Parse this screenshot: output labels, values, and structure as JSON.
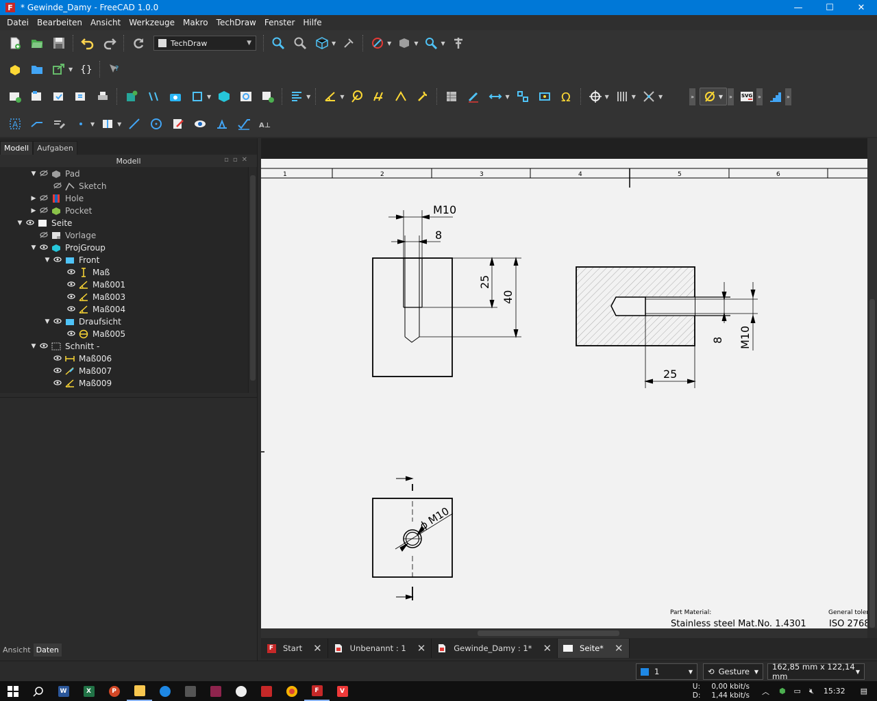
{
  "window": {
    "title": "* Gewinde_Damy - FreeCAD 1.0.0",
    "app_icon_letter": "F",
    "minimize": "—",
    "maximize": "☐",
    "close": "✕"
  },
  "menu": [
    "Datei",
    "Bearbeiten",
    "Ansicht",
    "Werkzeuge",
    "Makro",
    "TechDraw",
    "Fenster",
    "Hilfe"
  ],
  "workbench": {
    "selected": "TechDraw"
  },
  "left_panel": {
    "tabs": [
      "Modell",
      "Aufgaben"
    ],
    "tree_header": "Modell",
    "tree": [
      {
        "label": "Pad",
        "depth": 2,
        "arrow": "down",
        "icon": "pad-icon",
        "visible": false
      },
      {
        "label": "Sketch",
        "depth": 3,
        "arrow": "",
        "icon": "sketch-icon",
        "visible": false
      },
      {
        "label": "Hole",
        "depth": 2,
        "arrow": "right",
        "icon": "hole-icon",
        "visible": false
      },
      {
        "label": "Pocket",
        "depth": 2,
        "arrow": "right",
        "icon": "pocket-icon",
        "visible": false
      },
      {
        "label": "Seite",
        "depth": 1,
        "arrow": "down",
        "icon": "page-icon",
        "visible": true
      },
      {
        "label": "Vorlage",
        "depth": 2,
        "arrow": "",
        "icon": "template-icon",
        "visible": false
      },
      {
        "label": "ProjGroup",
        "depth": 2,
        "arrow": "down",
        "icon": "projgroup-icon",
        "visible": true
      },
      {
        "label": "Front",
        "depth": 3,
        "arrow": "down",
        "icon": "view-icon",
        "visible": true
      },
      {
        "label": "Maß",
        "depth": 4,
        "arrow": "",
        "icon": "length-dimension-icon",
        "visible": true
      },
      {
        "label": "Maß001",
        "depth": 4,
        "arrow": "",
        "icon": "angle-dimension-icon",
        "visible": true
      },
      {
        "label": "Maß003",
        "depth": 4,
        "arrow": "",
        "icon": "angle-dimension-icon",
        "visible": true
      },
      {
        "label": "Maß004",
        "depth": 4,
        "arrow": "",
        "icon": "angle-dimension-icon",
        "visible": true
      },
      {
        "label": "Draufsicht",
        "depth": 3,
        "arrow": "down",
        "icon": "view-icon",
        "visible": true
      },
      {
        "label": "Maß005",
        "depth": 4,
        "arrow": "",
        "icon": "diameter-dimension-icon",
        "visible": true
      },
      {
        "label": "Schnitt  -",
        "depth": 2,
        "arrow": "down",
        "icon": "section-icon",
        "visible": true
      },
      {
        "label": "Maß006",
        "depth": 3,
        "arrow": "",
        "icon": "horizontal-dimension-icon",
        "visible": true
      },
      {
        "label": "Maß007",
        "depth": 3,
        "arrow": "",
        "icon": "edit-dimension-icon",
        "visible": true
      },
      {
        "label": "Maß009",
        "depth": 3,
        "arrow": "",
        "icon": "angle-dimension-icon",
        "visible": true
      }
    ],
    "bottom_tabs": [
      "Ansicht",
      "Daten"
    ]
  },
  "drawing": {
    "ruler": [
      "1",
      "2",
      "3",
      "4",
      "5",
      "6"
    ],
    "dims": {
      "m10_front": "M10",
      "eight_front": "8",
      "twentyfive_front": "25",
      "forty_front": "40",
      "eight_section": "8",
      "m10_section": "M10",
      "twentyfive_section": "25",
      "diameter_top": "ϕ M10"
    },
    "title_block": {
      "material_label": "Part Material:",
      "material_value": "Stainless steel Mat.No. 1.4301",
      "tolerance_label": "General toler",
      "tolerance_value": "ISO 2768"
    }
  },
  "doc_tabs": [
    {
      "label": "Start",
      "icon": "freecad-icon",
      "active": false
    },
    {
      "label": "Unbenannt : 1",
      "icon": "document-icon",
      "active": false
    },
    {
      "label": "Gewinde_Damy : 1*",
      "icon": "document-icon",
      "active": false
    },
    {
      "label": "Seite*",
      "icon": "page-icon",
      "active": true
    }
  ],
  "status": {
    "page_number": "1",
    "navigation": "Gesture",
    "dimensions": "162,85 mm x 122,14 mm"
  },
  "taskbar": {
    "upload_label": "U:",
    "download_label": "D:",
    "upload_rate": "0,00 kbit/s",
    "download_rate": "1,44 kbit/s",
    "time": "15:32"
  },
  "colors": {
    "accent": "#0078d7",
    "tree_bg": "#262626",
    "drawing_bg": "#f2f2f2"
  }
}
